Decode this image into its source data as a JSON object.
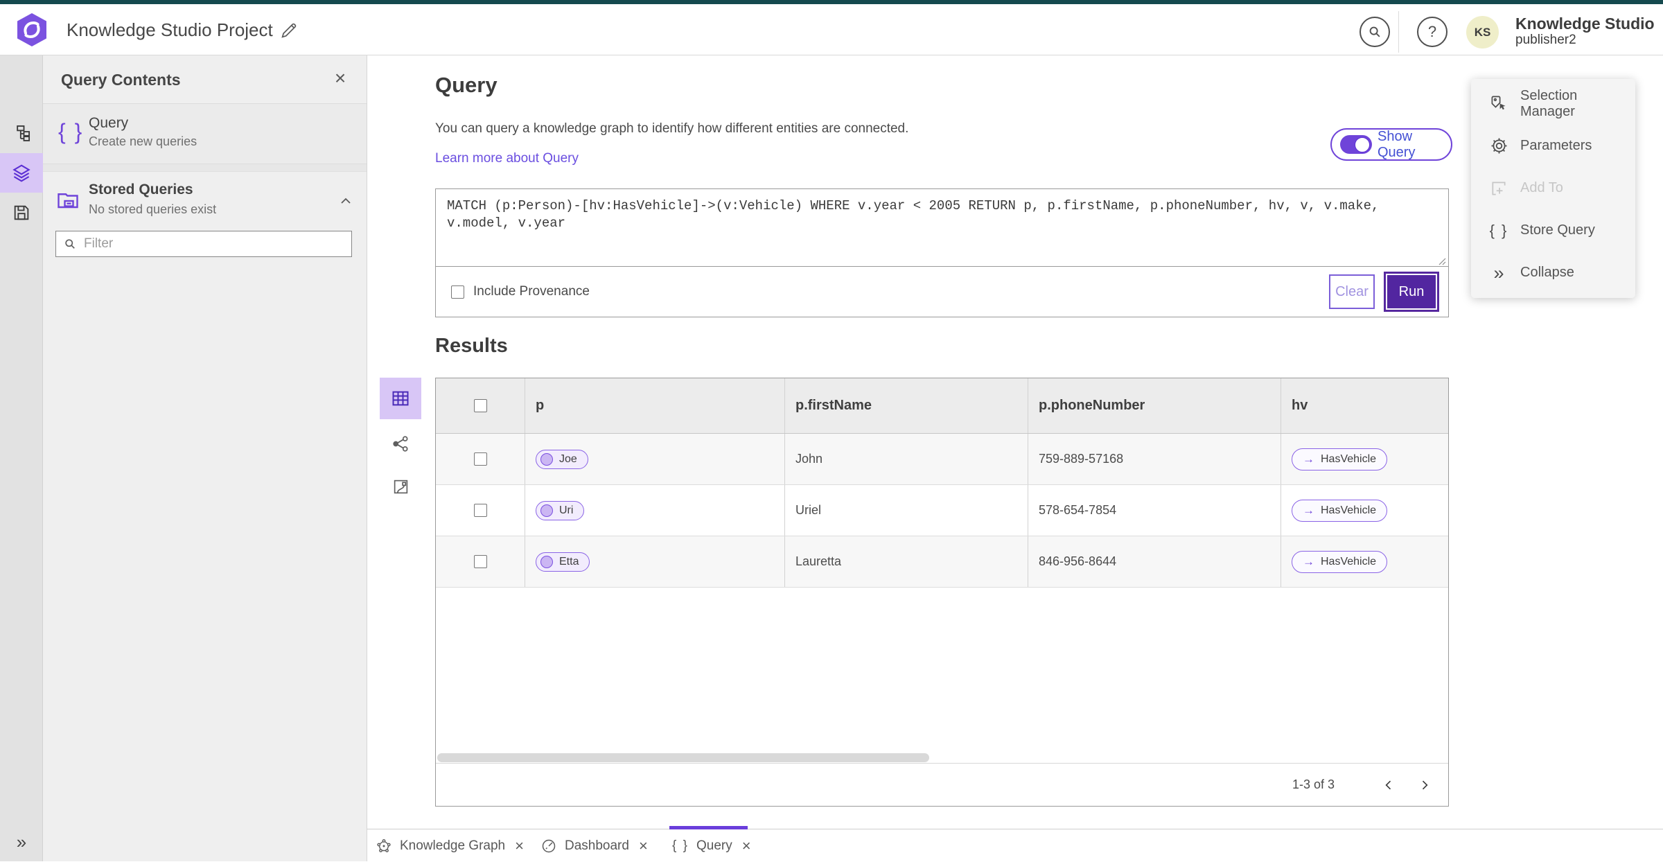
{
  "topbar": {
    "project_title": "Knowledge Studio Project",
    "help_glyph": "?",
    "user_initials": "KS",
    "user_line1": "Knowledge Studio",
    "user_line2": "publisher2"
  },
  "panel": {
    "title": "Query Contents",
    "close_glyph": "×",
    "query_item": {
      "icon_glyph": "{ }",
      "title": "Query",
      "subtitle": "Create new queries"
    },
    "stored_item": {
      "title": "Stored Queries",
      "subtitle": "No stored queries exist"
    },
    "filter_placeholder": "Filter"
  },
  "main": {
    "title": "Query",
    "description": "You can query a knowledge graph to identify how different entities are connected.",
    "learn_more": "Learn more about Query",
    "show_query_label": "Show Query",
    "query_text": "MATCH (p:Person)-[hv:HasVehicle]->(v:Vehicle) WHERE v.year < 2005 RETURN p, p.firstName, p.phoneNumber, hv, v, v.make, v.model, v.year",
    "include_provenance_label": "Include Provenance",
    "clear_label": "Clear",
    "run_label": "Run"
  },
  "results": {
    "title": "Results",
    "columns": {
      "c1": "p",
      "c2": "p.firstName",
      "c3": "p.phoneNumber",
      "c4": "hv"
    },
    "rel_arrow_glyph": "→",
    "rows": [
      {
        "p": "Joe",
        "firstName": "John",
        "phoneNumber": "759-889-57168",
        "hv": "HasVehicle"
      },
      {
        "p": "Uri",
        "firstName": "Uriel",
        "phoneNumber": "578-654-7854",
        "hv": "HasVehicle"
      },
      {
        "p": "Etta",
        "firstName": "Lauretta",
        "phoneNumber": "846-956-8644",
        "hv": "HasVehicle"
      }
    ],
    "pagination_label": "1-3 of 3"
  },
  "right_menu": {
    "items": [
      {
        "label": "Selection Manager"
      },
      {
        "label": "Parameters"
      },
      {
        "label": "Add To"
      },
      {
        "label": "Store Query",
        "icon_glyph": "{ }"
      },
      {
        "label": "Collapse",
        "icon_glyph": "»"
      }
    ]
  },
  "tabs": [
    {
      "label": "Knowledge Graph",
      "close_glyph": "×"
    },
    {
      "label": "Dashboard",
      "close_glyph": "×"
    },
    {
      "label": "Query",
      "icon_glyph": "{ }",
      "close_glyph": "×",
      "active": true
    }
  ],
  "sidebar": {
    "expand_glyph": "»"
  },
  "colors": {
    "accent_purple": "#6f44d9",
    "run_button": "#5226a0",
    "top_strip_teal": "#15494e",
    "selected_icon_bg": "#d8c6f6",
    "avatar_bg": "#efeec9"
  }
}
